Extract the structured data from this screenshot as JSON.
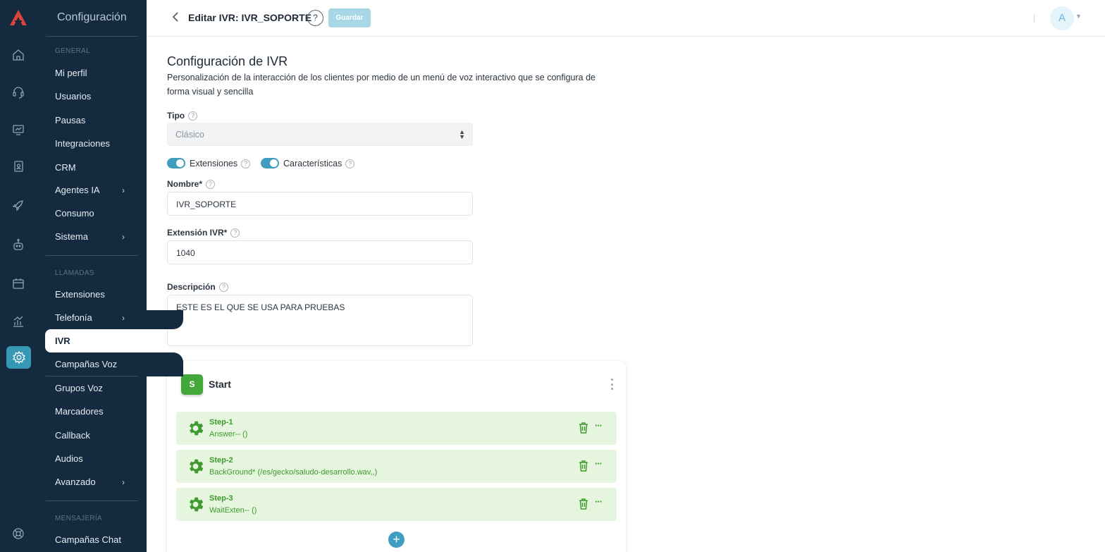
{
  "menu": {
    "title": "Configuración",
    "sections": {
      "general": "GENERAL",
      "calls": "LLAMADAS",
      "messaging": "MENSAJERÍA"
    },
    "items": {
      "profile": "Mi perfil",
      "users": "Usuarios",
      "pauses": "Pausas",
      "integrations": "Integraciones",
      "crm": "CRM",
      "ai_agents": "Agentes IA",
      "usage": "Consumo",
      "system": "Sistema",
      "extensions": "Extensiones",
      "telephony": "Telefonía",
      "ivr": "IVR",
      "voice_campaigns": "Campañas Voz",
      "voice_groups": "Grupos Voz",
      "dialers": "Marcadores",
      "callback": "Callback",
      "audios": "Audios",
      "advanced": "Avanzado",
      "chat_campaigns": "Campañas Chat"
    }
  },
  "header": {
    "title": "Editar IVR: IVR_SOPORTE",
    "help": "?",
    "save_label": "Guardar",
    "avatar_initial": "A"
  },
  "form": {
    "heading": "Configuración de IVR",
    "description": "Personalización de la interacción de los clientes por medio de un menú de voz interactivo que se configura de forma visual y sencilla",
    "type_label": "Tipo",
    "type_value": "Clásico",
    "extensions_toggle": "Extensiones",
    "features_toggle": "Características",
    "name_label": "Nombre*",
    "name_value": "IVR_SOPORTE",
    "ext_label": "Extensión IVR*",
    "ext_value": "1040",
    "desc_label": "Descripción",
    "desc_value": "ESTE ES EL QUE SE USA PARA PRUEBAS",
    "help_glyph": "?"
  },
  "flow": {
    "badge": "S",
    "title": "Start",
    "steps": [
      {
        "name": "Step-1",
        "command": "Answer-- ()"
      },
      {
        "name": "Step-2",
        "command": "BackGround* (/es/gecko/saludo-desarrollo.wav,,)"
      },
      {
        "name": "Step-3",
        "command": "WaitExten-- ()"
      }
    ],
    "more_glyph": "···",
    "add_glyph": "+"
  },
  "colors": {
    "sidebar_bg": "#132a3f",
    "accent": "#3798b6",
    "step_bg": "#e6f5dd",
    "step_text": "#3f9a2f",
    "start_badge": "#44a73a"
  }
}
